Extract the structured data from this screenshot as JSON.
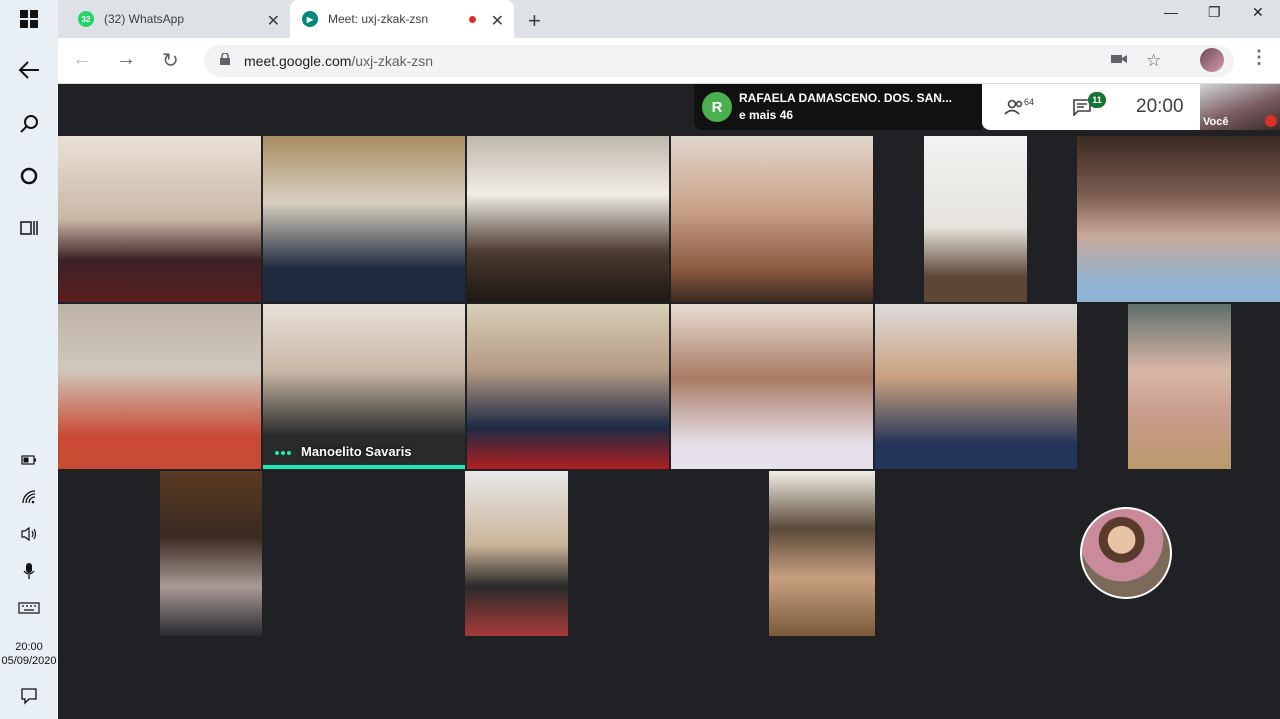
{
  "taskbar": {
    "time": "20:00",
    "date": "05/09/2020",
    "icons": [
      "windows-logo-icon",
      "back-arrow-icon",
      "search-icon",
      "cortana-circle-icon",
      "task-view-icon",
      "battery-icon",
      "wifi-icon",
      "volume-icon",
      "microphone-icon",
      "keyboard-icon",
      "notification-icon"
    ]
  },
  "tabs": [
    {
      "label": "(32) WhatsApp",
      "badge": "32",
      "active": false
    },
    {
      "label": "Meet: uxj-zkak-zsn",
      "active": true,
      "recording": true
    }
  ],
  "omnibox": {
    "domain": "meet.google.com",
    "path": "/uxj-zkak-zsn"
  },
  "meet": {
    "presenter_initial": "R",
    "presenter_name": "RAFAELA DAMASCENO. DOS. SAN...",
    "presenter_more": "e mais 46",
    "people_count": "64",
    "chat_count": "11",
    "clock": "20:00",
    "self_label": "Você",
    "speaker_name": "Manoelito Savaris"
  },
  "colors": {
    "meet_bg": "#202124",
    "speaking_accent": "#1de9b6",
    "chat_badge": "#137333",
    "presenter_badge": "#4caf50"
  }
}
